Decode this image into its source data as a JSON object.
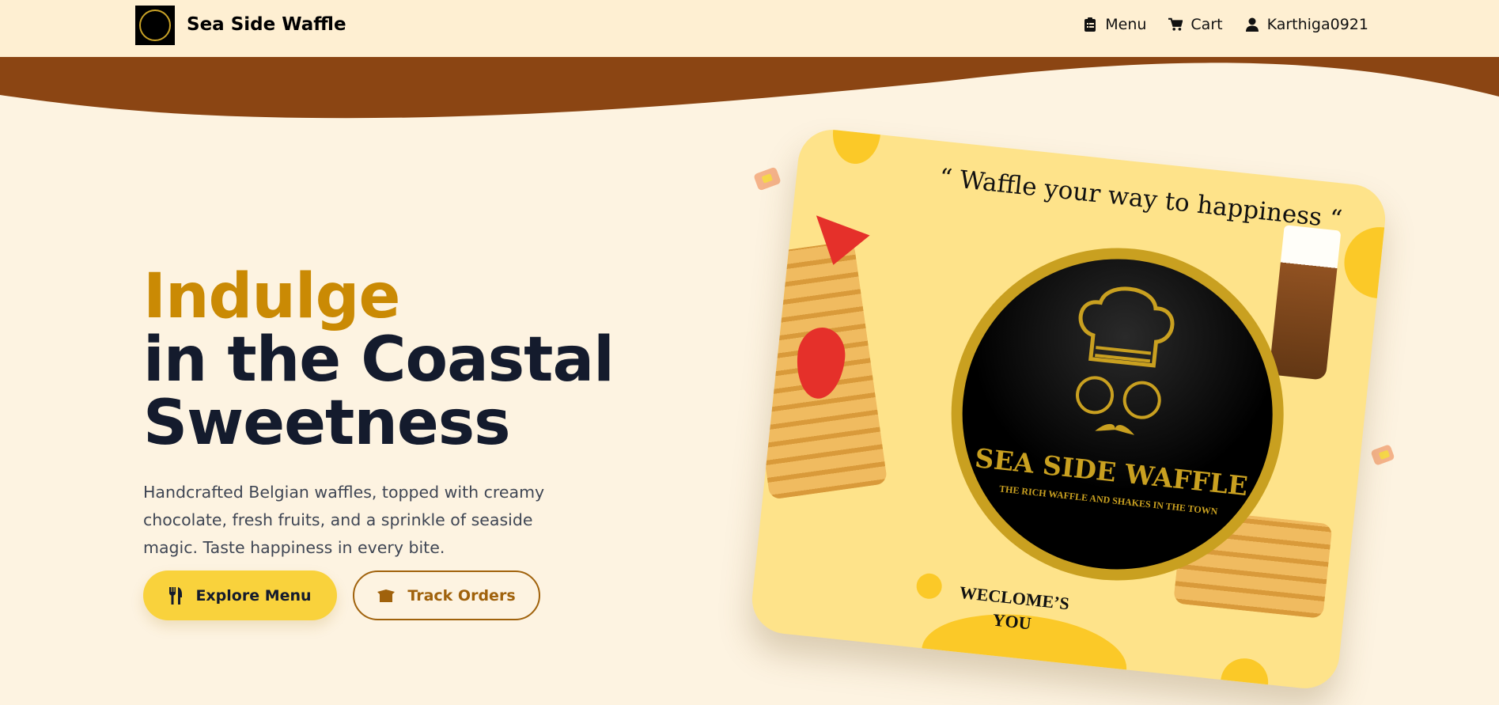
{
  "header": {
    "brand": "Sea Side Waffle",
    "nav": [
      {
        "label": "Menu",
        "icon": "clipboard-list-icon"
      },
      {
        "label": "Cart",
        "icon": "cart-icon"
      },
      {
        "label": "Karthiga0921",
        "icon": "user-icon"
      }
    ]
  },
  "hero": {
    "title_accent": "Indulge",
    "title_line2": "in the Coastal",
    "title_line3": "Sweetness",
    "description": "Handcrafted Belgian waffles, topped with creamy chocolate, fresh fruits, and a sprinkle of seaside magic. Taste happiness in every bite.",
    "primary_button": {
      "label": "Explore Menu",
      "icon": "utensils-icon"
    },
    "secondary_button": {
      "label": "Track Orders",
      "icon": "box-open-icon"
    }
  },
  "banner": {
    "quote": "“ Waffle your way to happiness “",
    "logo_title": "SEA SIDE WAFFLE",
    "logo_subtitle": "THE RICH WAFFLE AND SHAKES IN THE TOWN",
    "welcome_line1": "WECLOME’S",
    "welcome_line2": "YOU"
  },
  "colors": {
    "accent": "#ca8a04",
    "brown": "#8b4513",
    "yellow": "#f9d23c",
    "header_bg": "#feefd2",
    "page_bg": "#fdf3e1"
  }
}
